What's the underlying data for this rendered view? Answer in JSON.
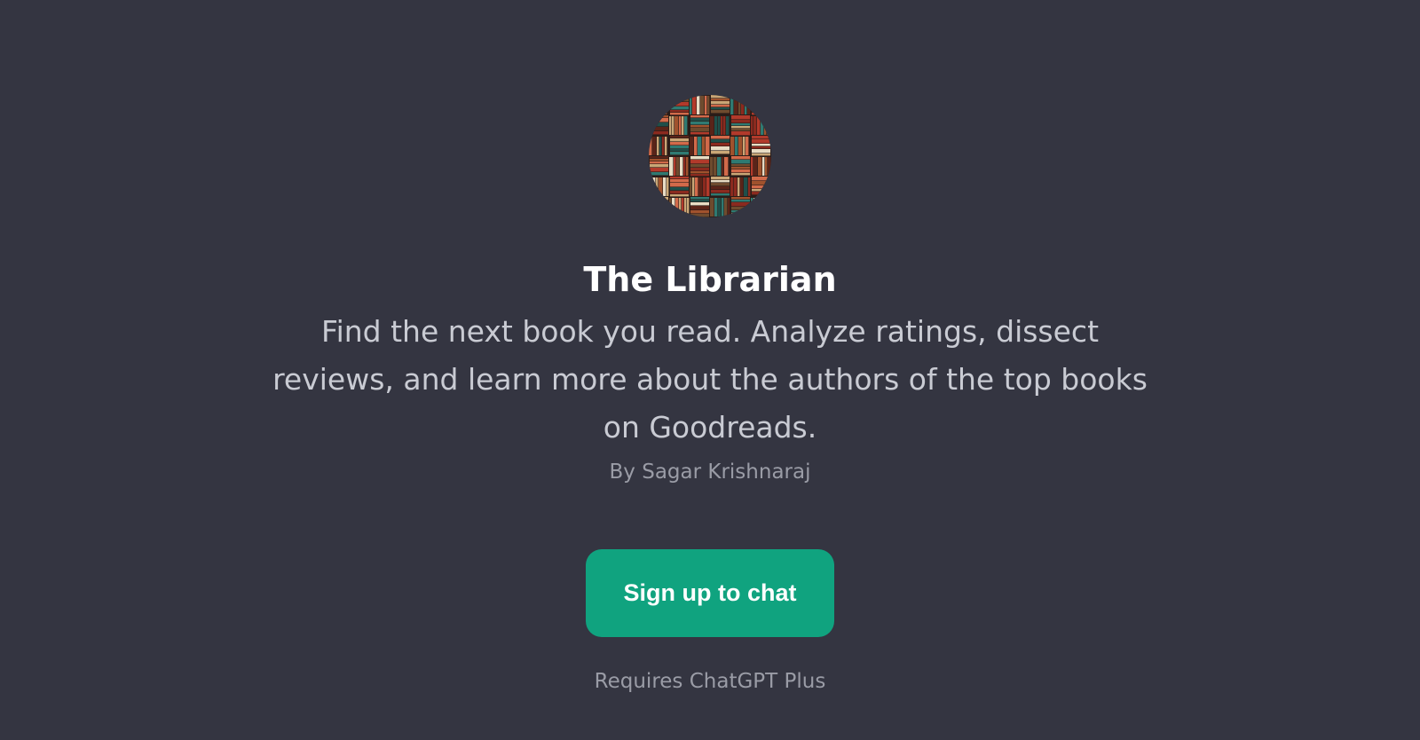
{
  "gpt": {
    "title": "The Librarian",
    "description": "Find the next book you read. Analyze ratings, dissect reviews, and learn more about the authors of the top books on Goodreads.",
    "byline": "By Sagar Krishnaraj",
    "avatar_icon": "bookshelf-avatar-icon"
  },
  "actions": {
    "signup_label": "Sign up to chat",
    "requirement_note": "Requires ChatGPT Plus"
  },
  "colors": {
    "background": "#343541",
    "accent": "#10a37f",
    "title": "#ffffff",
    "description": "#c9cbd3",
    "muted": "#9a9ca6"
  }
}
